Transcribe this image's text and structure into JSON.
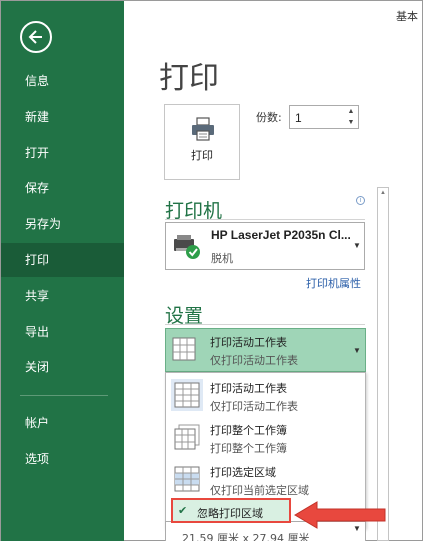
{
  "sidebar": {
    "items": [
      {
        "label": "信息"
      },
      {
        "label": "新建"
      },
      {
        "label": "打开"
      },
      {
        "label": "保存"
      },
      {
        "label": "另存为"
      },
      {
        "label": "打印"
      },
      {
        "label": "共享"
      },
      {
        "label": "导出"
      },
      {
        "label": "关闭"
      },
      {
        "label": "帐户"
      },
      {
        "label": "选项"
      }
    ],
    "active": "打印"
  },
  "window": {
    "top_right_text": "基本"
  },
  "page": {
    "title": "打印"
  },
  "print": {
    "button_label": "打印",
    "copies_label": "份数:",
    "copies_value": "1"
  },
  "printer": {
    "heading": "打印机",
    "name": "HP LaserJet P2035n Cl...",
    "status": "脱机",
    "properties_link": "打印机属性"
  },
  "settings": {
    "heading": "设置",
    "selected": {
      "title": "打印活动工作表",
      "subtitle": "仅打印活动工作表"
    },
    "options": [
      {
        "title": "打印活动工作表",
        "subtitle": "仅打印活动工作表"
      },
      {
        "title": "打印整个工作簿",
        "subtitle": "打印整个工作簿"
      },
      {
        "title": "打印选定区域",
        "subtitle": "仅打印当前选定区域"
      }
    ],
    "ignore_print_area": {
      "label": "忽略打印区域",
      "checked": true
    },
    "paper_size": "21.59 厘米 x 27.94 厘米"
  },
  "colors": {
    "accent": "#217346",
    "highlight": "#e8483e"
  }
}
